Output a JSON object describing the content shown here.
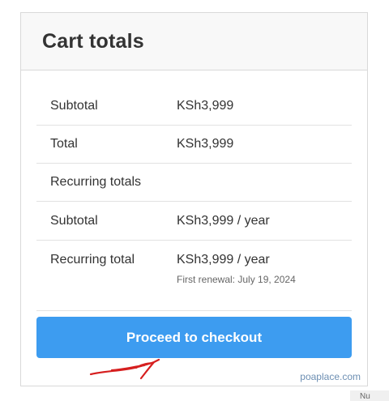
{
  "card": {
    "title": "Cart totals"
  },
  "rows": [
    {
      "label": "Subtotal",
      "value": "KSh3,999"
    },
    {
      "label": "Total",
      "value": "KSh3,999"
    },
    {
      "label": "Recurring totals",
      "value": ""
    },
    {
      "label": "Subtotal",
      "value": "KSh3,999 / year"
    },
    {
      "label": "Recurring total",
      "value": "KSh3,999 / year",
      "note": "First renewal: July 19, 2024"
    }
  ],
  "checkout": {
    "label": "Proceed to checkout"
  },
  "watermark": "poaplace.com",
  "corner_text": "Nu",
  "colors": {
    "accent": "#3d9cf0",
    "annotation": "#d61f1f",
    "header_bg": "#f8f8f8"
  }
}
